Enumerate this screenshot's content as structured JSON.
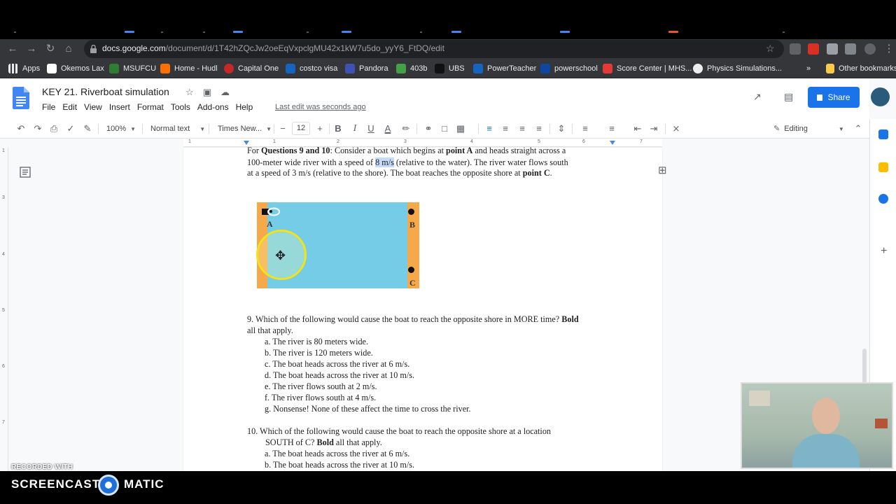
{
  "browser": {
    "url_host": "docs.google.com",
    "url_path": "/document/d/1T42hZQcJw2oeEqVxpclgMU42x1kW7u5do_yyY6_FtDQ/edit",
    "icons": [
      "back-icon",
      "forward-icon",
      "reload-icon",
      "home-icon",
      "lock-icon",
      "star-icon",
      "extensions-icon"
    ]
  },
  "bookmarks": [
    {
      "label": "Apps",
      "color": "#e8eaed"
    },
    {
      "label": "Okemos Lax",
      "color": "#ffffff"
    },
    {
      "label": "MSUFCU",
      "color": "#2e7d32"
    },
    {
      "label": "Home - Hudl",
      "color": "#ff6f00"
    },
    {
      "label": "Capital One",
      "color": "#c62828"
    },
    {
      "label": "costco visa",
      "color": "#1565c0"
    },
    {
      "label": "Pandora",
      "color": "#3f51b5"
    },
    {
      "label": "403b",
      "color": "#43a047"
    },
    {
      "label": "UBS",
      "color": "#111111"
    },
    {
      "label": "PowerTeacher",
      "color": "#1565c0"
    },
    {
      "label": "powerschool",
      "color": "#0d47a1"
    },
    {
      "label": "Score Center | MHS...",
      "color": "#e53935"
    },
    {
      "label": "Physics Simulations...",
      "color": "#eeeeee"
    }
  ],
  "bookmarks_more": "»",
  "other_bookmarks": "Other bookmarks",
  "docs": {
    "title": "KEY 21. Riverboat simulation",
    "menu": [
      "File",
      "Edit",
      "View",
      "Insert",
      "Format",
      "Tools",
      "Add-ons",
      "Help"
    ],
    "last_edit": "Last edit was seconds ago",
    "share_label": "Share",
    "editing_label": "Editing"
  },
  "toolbar": {
    "zoom": "100%",
    "style": "Normal text",
    "font": "Times New...",
    "font_size": "12",
    "bold": "B",
    "italic": "I",
    "underline": "U",
    "text_color": "A"
  },
  "ruler": [
    "1",
    "1",
    "2",
    "3",
    "4",
    "5",
    "6",
    "7"
  ],
  "vruler": [
    "1",
    "3",
    "4",
    "5",
    "6",
    "7"
  ],
  "document": {
    "intro_1a": "For ",
    "intro_1b": "Questions 9 and 10",
    "intro_1c": ": Consider a boat which begins at ",
    "intro_1d": "point A",
    "intro_1e": " and heads straight across a",
    "intro_2a": "100-meter wide river  with a speed of ",
    "intro_2b": "8 m/s",
    "intro_2c": " (relative to the water). The river  water flows south",
    "intro_3a": "at a speed of 3 m/s (relative to the  shore). The boat reaches the opposite shore at ",
    "intro_3b": "point C",
    "intro_3c": ".",
    "figure_labels": {
      "a": "A",
      "b": "B",
      "c": "C"
    },
    "q9_a": "9. Which of the following would cause the boat to reach the opposite shore in MORE time? ",
    "q9_bold": "Bold",
    "q9_b": "all  that apply.",
    "q9_options": [
      "a. The river is 80 meters wide.",
      "b. The river is 120 meters wide.",
      "c. The boat heads across the river at 6 m/s.",
      "d. The boat heads across the river at 10 m/s.",
      "e. The river flows south at 2 m/s.",
      "f. The river flows south at 4 m/s.",
      "g. Nonsense! None of these affect the time to cross the river."
    ],
    "q10_a": "10. Which of the following would cause the boat to reach the opposite shore at a location",
    "q10_b": "SOUTH of C? ",
    "q10_bold": "Bold",
    "q10_c": " all that apply.",
    "q10_options": [
      "a. The boat heads across the river at 6 m/s.",
      "b. The boat heads across the river at 10 m/s."
    ]
  },
  "screencast": {
    "recorded_with": "RECORDED WITH",
    "brand_left": "SCREENCAST",
    "brand_right": "MATIC"
  }
}
